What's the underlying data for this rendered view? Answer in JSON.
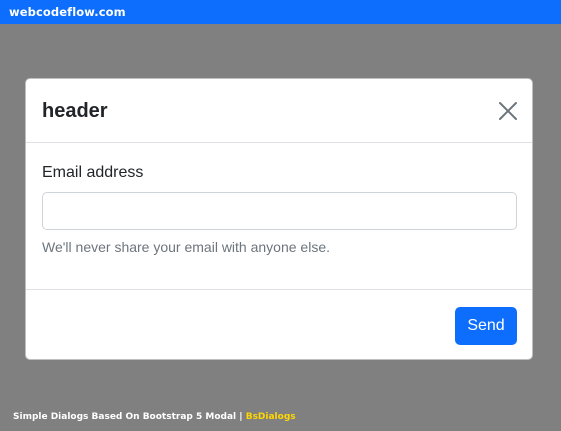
{
  "site": {
    "brand": "webcodeflow.com",
    "brand_color": "#0d6efd"
  },
  "modal": {
    "title": "header",
    "close_icon": "close-icon",
    "field_label": "Email address",
    "email_value": "",
    "help_text": "We'll never share your email with anyone else.",
    "send_label": "Send",
    "send_color": "#0d6efd"
  },
  "caption": {
    "text": "Simple Dialogs Based On Bootstrap 5 Modal",
    "separator": "|",
    "plugin": "BsDialogs",
    "plugin_color": "#ffd700"
  },
  "backdrop_color": "#808080"
}
